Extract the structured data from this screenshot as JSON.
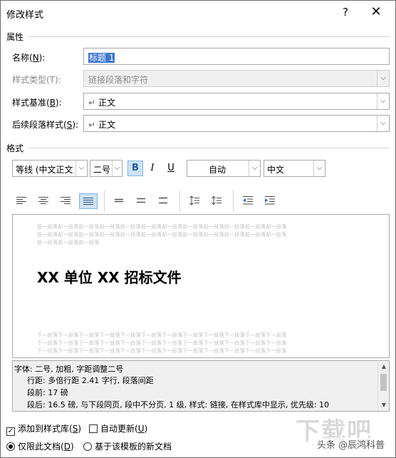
{
  "window": {
    "title": "修改样式",
    "help": "?",
    "close": "✕"
  },
  "properties": {
    "section": "属性",
    "name_label": "名称(",
    "name_key": "N",
    "name_suffix": "):",
    "name_value": "标题 1",
    "type_label": "样式类型(T):",
    "type_value": "链接段落和字符",
    "based_label": "样式基准(",
    "based_key": "B",
    "based_suffix": "):",
    "based_value": "正文",
    "next_label": "后续段落样式(",
    "next_key": "S",
    "next_suffix": "):",
    "next_value": "正文",
    "paragraph_mark": "↵",
    "dropdown_glyph": "⌵"
  },
  "format": {
    "section": "格式",
    "font": "等线 (中文正文",
    "size": "二号",
    "bold": "B",
    "italic": "I",
    "underline": "U",
    "color": "自动",
    "script": "中文"
  },
  "preview": {
    "before_lines": [
      "前一段落前一段落前一段落前一段落前一段落前一段落前一段落前一段落前一段落前一段落前一段落前一段落",
      "前一段落前一段落前一段落前一段落前一段落前一段落前一段落前一段落前一段落前一段落前一段落前一段落",
      "前一段落前一段落前一段落"
    ],
    "sample": "XX 单位 XX 招标文件",
    "after_lines": [
      "下一段落下一段落下一段落下一段落下一段落下一段落下一段落下一段落下一段落下一段落下一段落下一段落",
      "下一段落下一段落下一段落下一段落下一段落下一段落下一段落下一段落下一段落下一段落下一段落下一段落",
      "下一段落下一段落下一段落下一段落下一段落下一段落下一段落下一段落下一段落下一段落下一段落下一段落"
    ]
  },
  "description": {
    "line1": "字体: 二号, 加粗, 字距调整二号",
    "line2": "行距: 多倍行距 2.41 字行, 段落间距",
    "line3": "段前: 17 磅",
    "line4": "段后: 16.5 磅, 与下段同页, 段中不分页, 1 级, 样式: 链接, 在样式库中显示, 优先级: 10"
  },
  "options": {
    "add_to_gallery": "添加到样式库(",
    "add_to_gallery_key": "S",
    "add_to_gallery_checked": true,
    "auto_update": "自动更新(",
    "auto_update_key": "U",
    "auto_update_checked": false,
    "only_this_doc": "仅限此文档(",
    "only_this_doc_key": "D",
    "template_docs": "基于该模板的新文档",
    "close_paren": ")",
    "check_mark": "✓"
  },
  "watermark": {
    "big": "下载吧",
    "small": "头条 @辰鸿科普"
  }
}
